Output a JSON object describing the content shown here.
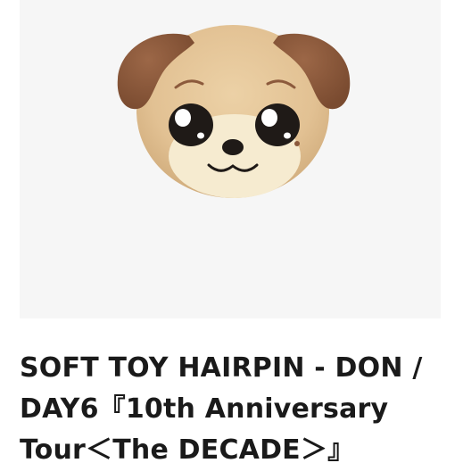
{
  "product": {
    "image_alt": "DON plush hairpin — tan puppy face with brown ears",
    "title": "SOFT TOY HAIRPIN - DON /\nDAY6『10th Anniversary\nTour＜The DECADE＞』"
  },
  "colors": {
    "image_background": "#f6f6f6",
    "fur": "#e2c193",
    "muzzle": "#f6ebd0",
    "ears": "#8c5a3c",
    "eyes": "#1f1a17",
    "title_text": "#1a1a1a"
  }
}
